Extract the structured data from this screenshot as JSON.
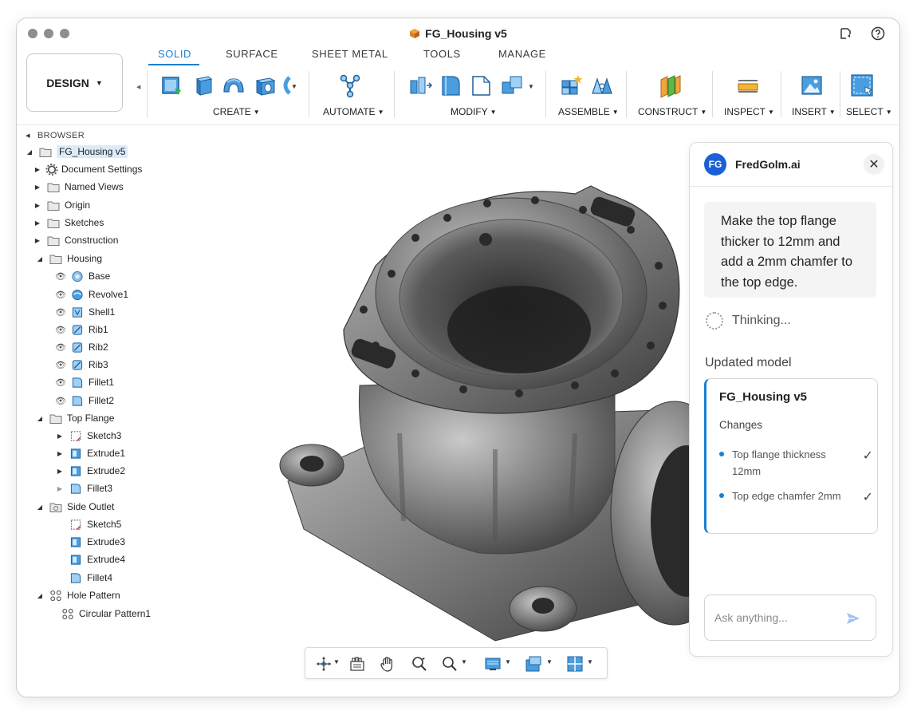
{
  "app": {
    "document_title": "FG_Housing v5",
    "workspace_button": "DESIGN"
  },
  "tabs": [
    {
      "label": "SOLID",
      "active": true
    },
    {
      "label": "SURFACE",
      "active": false
    },
    {
      "label": "SHEET METAL",
      "active": false
    },
    {
      "label": "TOOLS",
      "active": false
    },
    {
      "label": "MANAGE",
      "active": false
    }
  ],
  "toolbar_groups": [
    "CREATE",
    "AUTOMATE",
    "MODIFY",
    "ASSEMBLE",
    "CONSTRUCT",
    "INSPECT",
    "INSERT",
    "SELECT"
  ],
  "browser": {
    "header": "BROWSER",
    "root": "FG_Housing v5",
    "items": [
      "Document Settings",
      "Named Views",
      "Origin",
      "Sketches",
      "Construction",
      "Housing",
      "Base",
      "Revolve1",
      "Shell1",
      "Rib1",
      "Rib2",
      "Rib3",
      "Fillet1",
      "Fillet2",
      "Top Flange",
      "Sketch3",
      "Extrude1",
      "Extrude2",
      "Fillet3",
      "Side Outlet",
      "Sketch5",
      "Extrude3",
      "Extrude4",
      "Fillet4",
      "Hole Pattern",
      "Circular Pattern1"
    ]
  },
  "chat": {
    "avatar": "FG",
    "name": "FredGolm.ai",
    "user_message": "Make the top flange thicker to 12mm and add a 2mm chamfer to the top edge.",
    "status": "Thinking...",
    "updated_label": "Updated model",
    "card_title": "FG_Housing v5",
    "changes_label": "Changes",
    "changes": [
      {
        "text": "Top flange thickness 12mm",
        "done": true
      },
      {
        "text": "Top edge chamfer 2mm",
        "done": true
      }
    ],
    "input_placeholder": "Ask anything..."
  },
  "colors": {
    "accent": "#1b7fd0",
    "avatar": "#1b5fd6"
  }
}
